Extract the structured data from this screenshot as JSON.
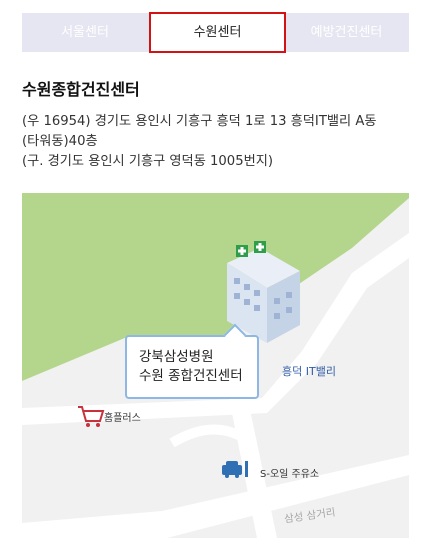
{
  "tabs": [
    {
      "label": "서울센터",
      "active": false
    },
    {
      "label": "수원센터",
      "active": true
    },
    {
      "label": "예방건진센터",
      "active": false
    }
  ],
  "center": {
    "title": "수원종합건진센터",
    "address_lines": [
      "(우 16954) 경기도 용인시 기흥구 흥덕 1로 13 흥덕IT밸리 A동",
      "(타워동)40층",
      "(구. 경기도 용인시 기흥구 영덕동 1005번지)"
    ]
  },
  "map": {
    "callout_lines": [
      "강북삼성병원",
      "수원 종합건진센터"
    ],
    "labels": {
      "it_valley": "흥덕 IT밸리",
      "homeplus": "홈플러스",
      "gas_station": "S-오일 주유소",
      "road": "삼성 삼거리"
    },
    "colors": {
      "park": "#b3d68c",
      "road": "#ffffff",
      "ground": "#f1f1f1",
      "accent": "#8eb8e3"
    }
  }
}
